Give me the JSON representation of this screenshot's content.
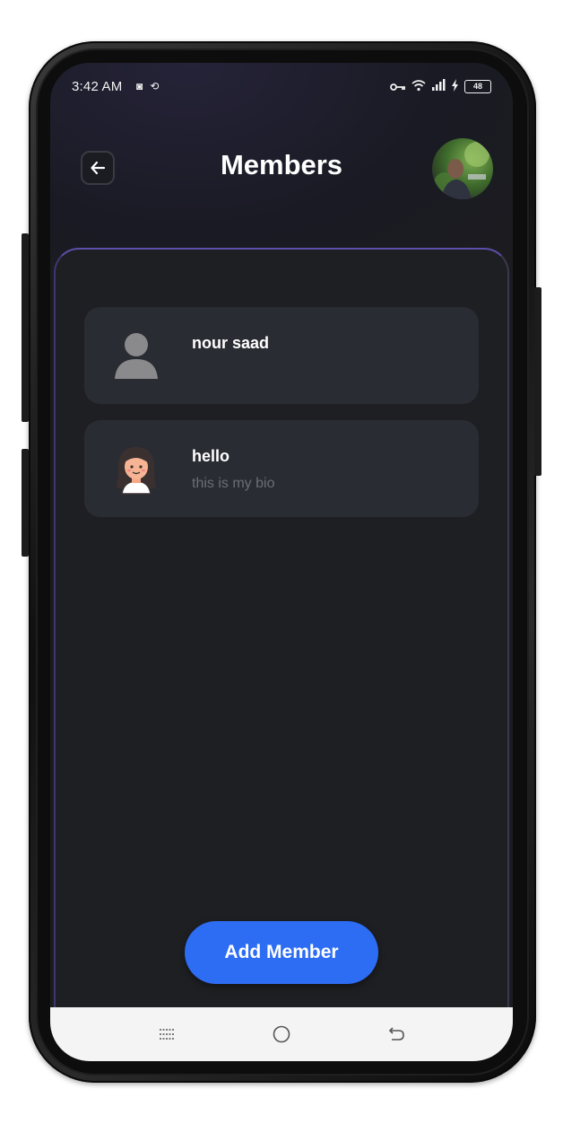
{
  "status_bar": {
    "time": "3:42 AM",
    "battery": "48"
  },
  "header": {
    "title": "Members"
  },
  "members": [
    {
      "name": "nour saad",
      "bio": "",
      "avatar": "default-person-icon"
    },
    {
      "name": "hello",
      "bio": "this is my bio",
      "avatar": "girl-avatar-icon"
    }
  ],
  "actions": {
    "add_member_label": "Add Member"
  },
  "colors": {
    "accent": "#2d6df3",
    "background": "#1c1c1f",
    "card": "#2a2c33",
    "panel_border": "#5b4fa8"
  },
  "nav": {
    "icons": [
      "menu-icon",
      "home-icon",
      "back-icon"
    ]
  }
}
